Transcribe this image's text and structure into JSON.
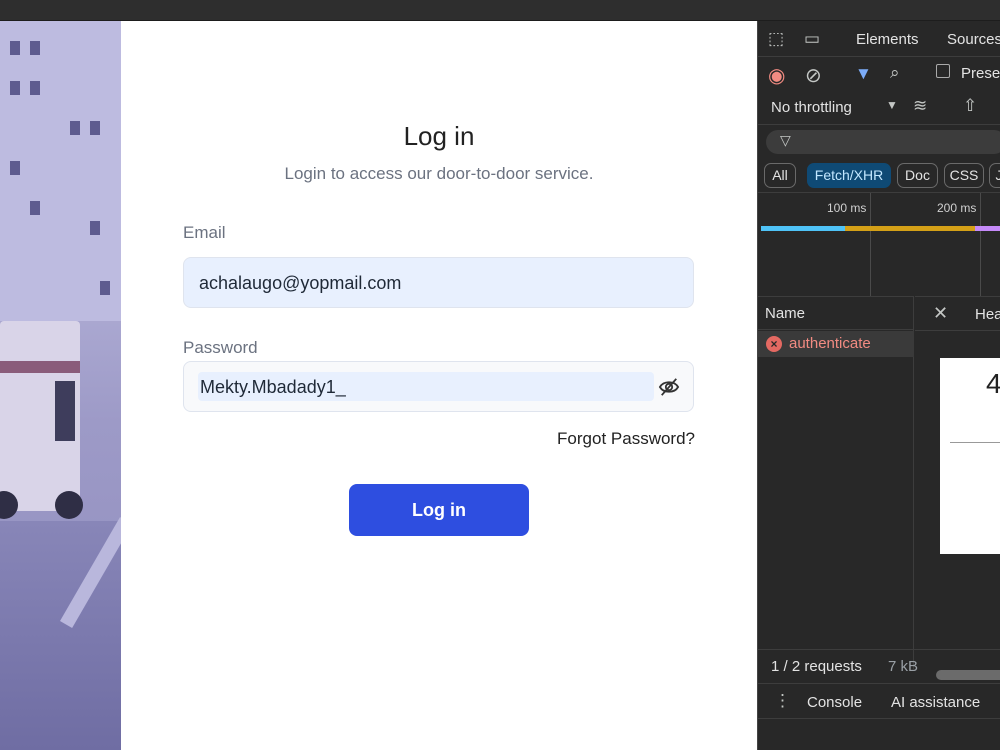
{
  "login": {
    "title": "Log in",
    "subtitle": "Login to access our door-to-door service.",
    "email_label": "Email",
    "email_value": "achalaugo@yopmail.com",
    "password_label": "Password",
    "password_value": "Mekty.Mbadady1_",
    "forgot_label": "Forgot Password?",
    "submit_label": "Log in",
    "accent": "#2e4ee0"
  },
  "devtools": {
    "tabs": [
      "Elements",
      "Sources"
    ],
    "preserve_label": "Preser",
    "throttling": "No throttling",
    "filter_chips": [
      "All",
      "Fetch/XHR",
      "Doc",
      "CSS",
      "J"
    ],
    "active_chip": "Fetch/XHR",
    "timeline_ticks": [
      "100 ms",
      "200 ms"
    ],
    "name_header": "Name",
    "detail_tab": "Hea",
    "requests": [
      {
        "name": "authenticate",
        "status": "error"
      }
    ],
    "detail_glyph": "4",
    "request_count": "1 / 2 requests",
    "transfer": "7 kB",
    "drawer_tabs": [
      "Console",
      "AI assistance"
    ]
  }
}
